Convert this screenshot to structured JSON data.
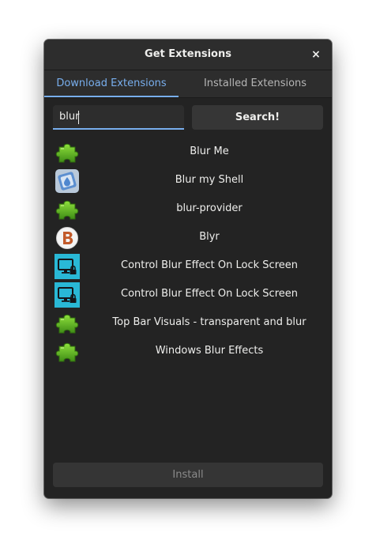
{
  "window": {
    "title": "Get Extensions",
    "close_label": "×"
  },
  "tabs": [
    {
      "label": "Download Extensions",
      "active": true
    },
    {
      "label": "Installed Extensions",
      "active": false
    }
  ],
  "search": {
    "value": "blur",
    "button_label": "Search!"
  },
  "results": [
    {
      "name": "Blur Me",
      "icon": "puzzle-icon"
    },
    {
      "name": "Blur my Shell",
      "icon": "blur-my-shell-icon"
    },
    {
      "name": "blur-provider",
      "icon": "puzzle-icon"
    },
    {
      "name": "Blyr",
      "icon": "blyr-icon"
    },
    {
      "name": "Control Blur Effect On Lock Screen",
      "icon": "lock-screen-icon"
    },
    {
      "name": "Control Blur Effect On Lock Screen",
      "icon": "lock-screen-icon"
    },
    {
      "name": "Top Bar Visuals - transparent and blur",
      "icon": "puzzle-icon"
    },
    {
      "name": "Windows Blur Effects",
      "icon": "puzzle-icon"
    }
  ],
  "install": {
    "label": "Install",
    "enabled": false
  },
  "colors": {
    "accent": "#78aeed",
    "window_bg": "#232323",
    "header_bg": "#2d2d2d",
    "puzzle_green": "#5aa924",
    "lock_screen_bg": "#29b8d6"
  }
}
